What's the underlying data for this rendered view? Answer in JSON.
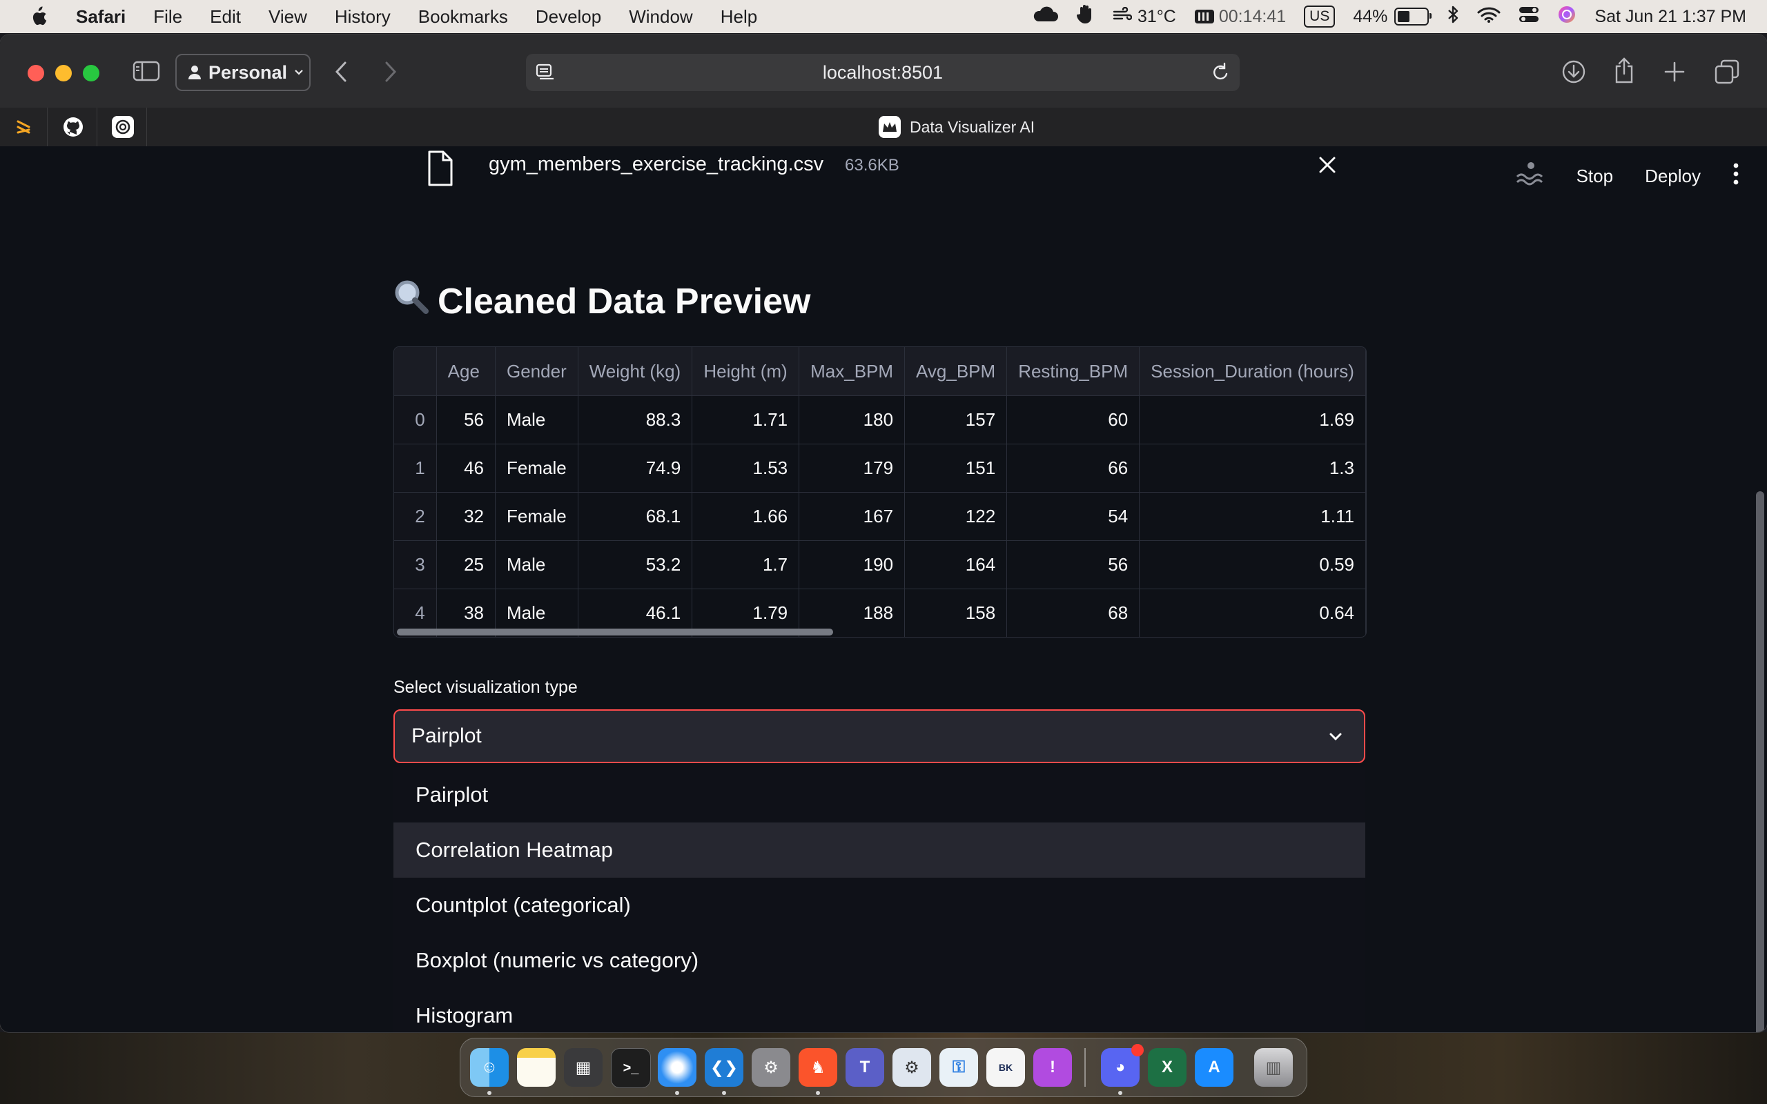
{
  "menubar": {
    "app_name": "Safari",
    "menus": [
      "File",
      "Edit",
      "View",
      "History",
      "Bookmarks",
      "Develop",
      "Window",
      "Help"
    ],
    "temperature": "31°C",
    "timer": "00:14:41",
    "keyboard": "US",
    "battery_percent": "44%",
    "battery_level": 0.44,
    "datetime": "Sat Jun 21  1:37 PM"
  },
  "browser": {
    "profile_label": "Personal",
    "url": "localhost:8501",
    "tab_title": "Data Visualizer AI"
  },
  "app": {
    "file_name": "gym_members_exercise_tracking.csv",
    "file_size": "63.6KB",
    "header_stop": "Stop",
    "header_deploy": "Deploy",
    "section_title": "Cleaned Data Preview",
    "table": {
      "columns": [
        "",
        "Age",
        "Gender",
        "Weight (kg)",
        "Height (m)",
        "Max_BPM",
        "Avg_BPM",
        "Resting_BPM",
        "Session_Duration (hours)"
      ],
      "rows": [
        [
          "0",
          "56",
          "Male",
          "88.3",
          "1.71",
          "180",
          "157",
          "60",
          "1.69"
        ],
        [
          "1",
          "46",
          "Female",
          "74.9",
          "1.53",
          "179",
          "151",
          "66",
          "1.3"
        ],
        [
          "2",
          "32",
          "Female",
          "68.1",
          "1.66",
          "167",
          "122",
          "54",
          "1.11"
        ],
        [
          "3",
          "25",
          "Male",
          "53.2",
          "1.7",
          "190",
          "164",
          "56",
          "0.59"
        ],
        [
          "4",
          "38",
          "Male",
          "46.1",
          "1.79",
          "188",
          "158",
          "68",
          "0.64"
        ]
      ]
    },
    "select_label": "Select visualization type",
    "select_value": "Pairplot",
    "options": [
      "Pairplot",
      "Correlation Heatmap",
      "Countplot (categorical)",
      "Boxplot (numeric vs category)",
      "Histogram"
    ],
    "highlighted_option": "Correlation Heatmap",
    "accent_color": "#ff4b4b"
  },
  "dock": {
    "apps": [
      "Finder",
      "Notes",
      "Calculator",
      "Terminal",
      "Safari",
      "VS Code",
      "System Settings",
      "Brave",
      "Teams",
      "Settings",
      "Keychain",
      "Brooklyn",
      "Feedback",
      "Discord",
      "Excel",
      "App Store",
      "Trash"
    ]
  }
}
